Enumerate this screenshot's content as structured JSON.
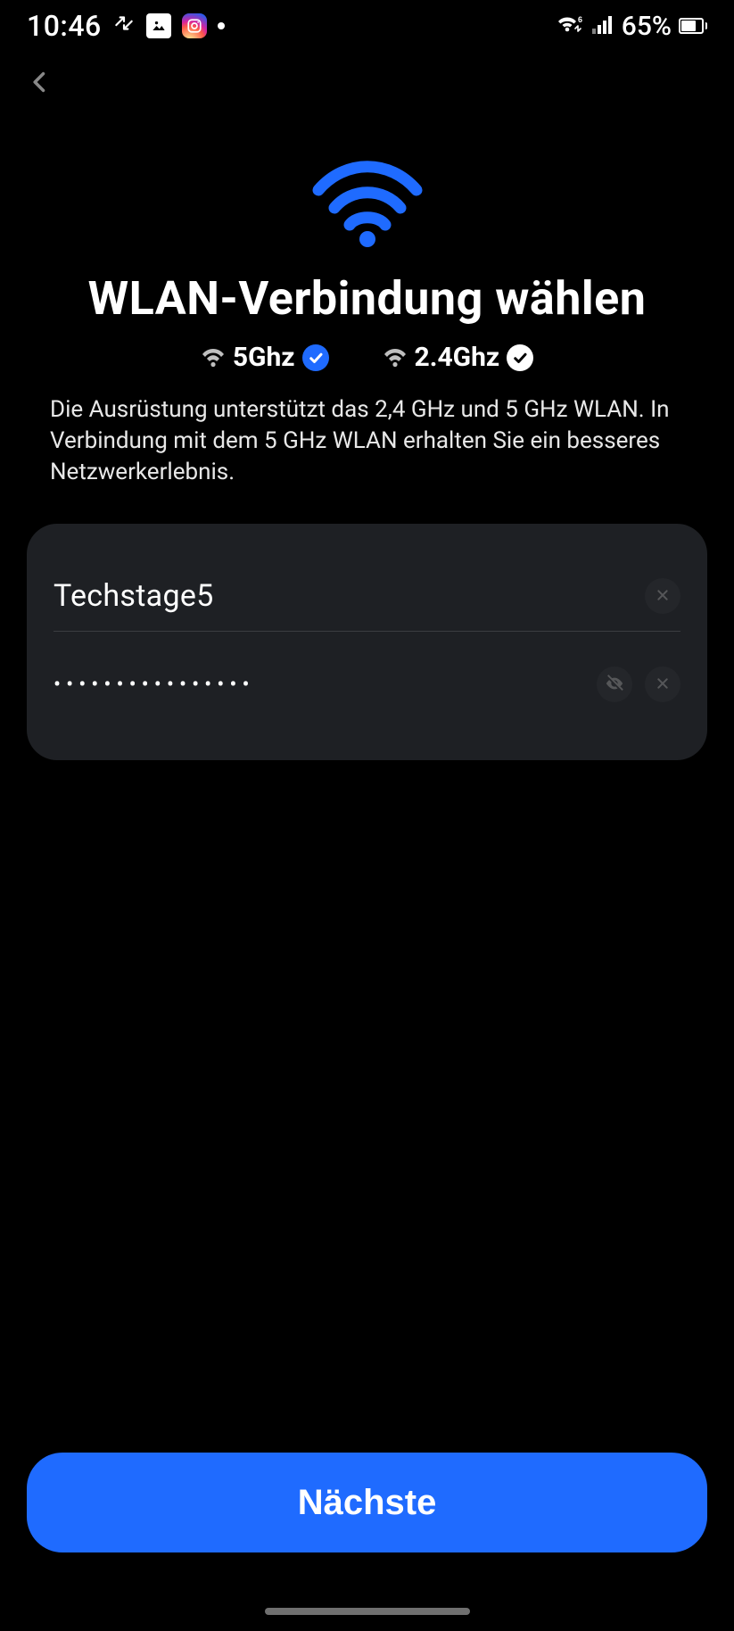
{
  "status": {
    "time": "10:46",
    "battery_text": "65%",
    "battery_level": 65
  },
  "page": {
    "title": "WLAN-Verbindung wählen",
    "bands": {
      "opt1": "5Ghz",
      "opt2": "2.4Ghz"
    },
    "description": "Die Ausrüstung unterstützt das 2,4 GHz und 5 GHz WLAN. In Verbindung mit dem 5 GHz WLAN erhalten Sie ein besseres Netzwerkerlebnis."
  },
  "form": {
    "ssid_value": "Techstage5",
    "password_value": "••••••••••••••••"
  },
  "actions": {
    "next_label": "Nächste"
  },
  "colors": {
    "accent": "#1f6bff",
    "card_bg": "#1e2024"
  }
}
